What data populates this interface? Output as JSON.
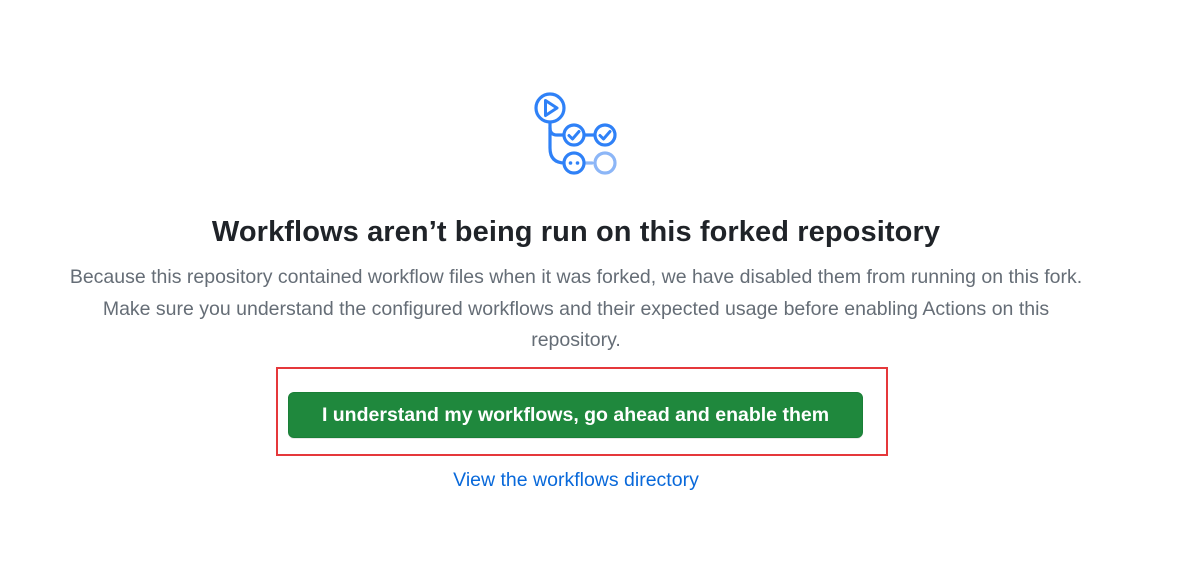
{
  "empty_state": {
    "illustration": "workflow-graph-icon",
    "title": "Workflows aren’t being run on this forked repository",
    "description": "Because this repository contained workflow files when it was forked, we have disabled them from running on this fork. Make sure you understand the configured workflows and their expected usage before enabling Actions on this repository.",
    "primary_button": "I understand my workflows, go ahead and enable them",
    "link": "View the workflows directory"
  },
  "colors": {
    "button_bg": "#1f883d",
    "link": "#0969da",
    "icon_blue": "#2f81f7",
    "icon_light_blue": "#8cb6f7",
    "highlight": "#e5383b"
  }
}
